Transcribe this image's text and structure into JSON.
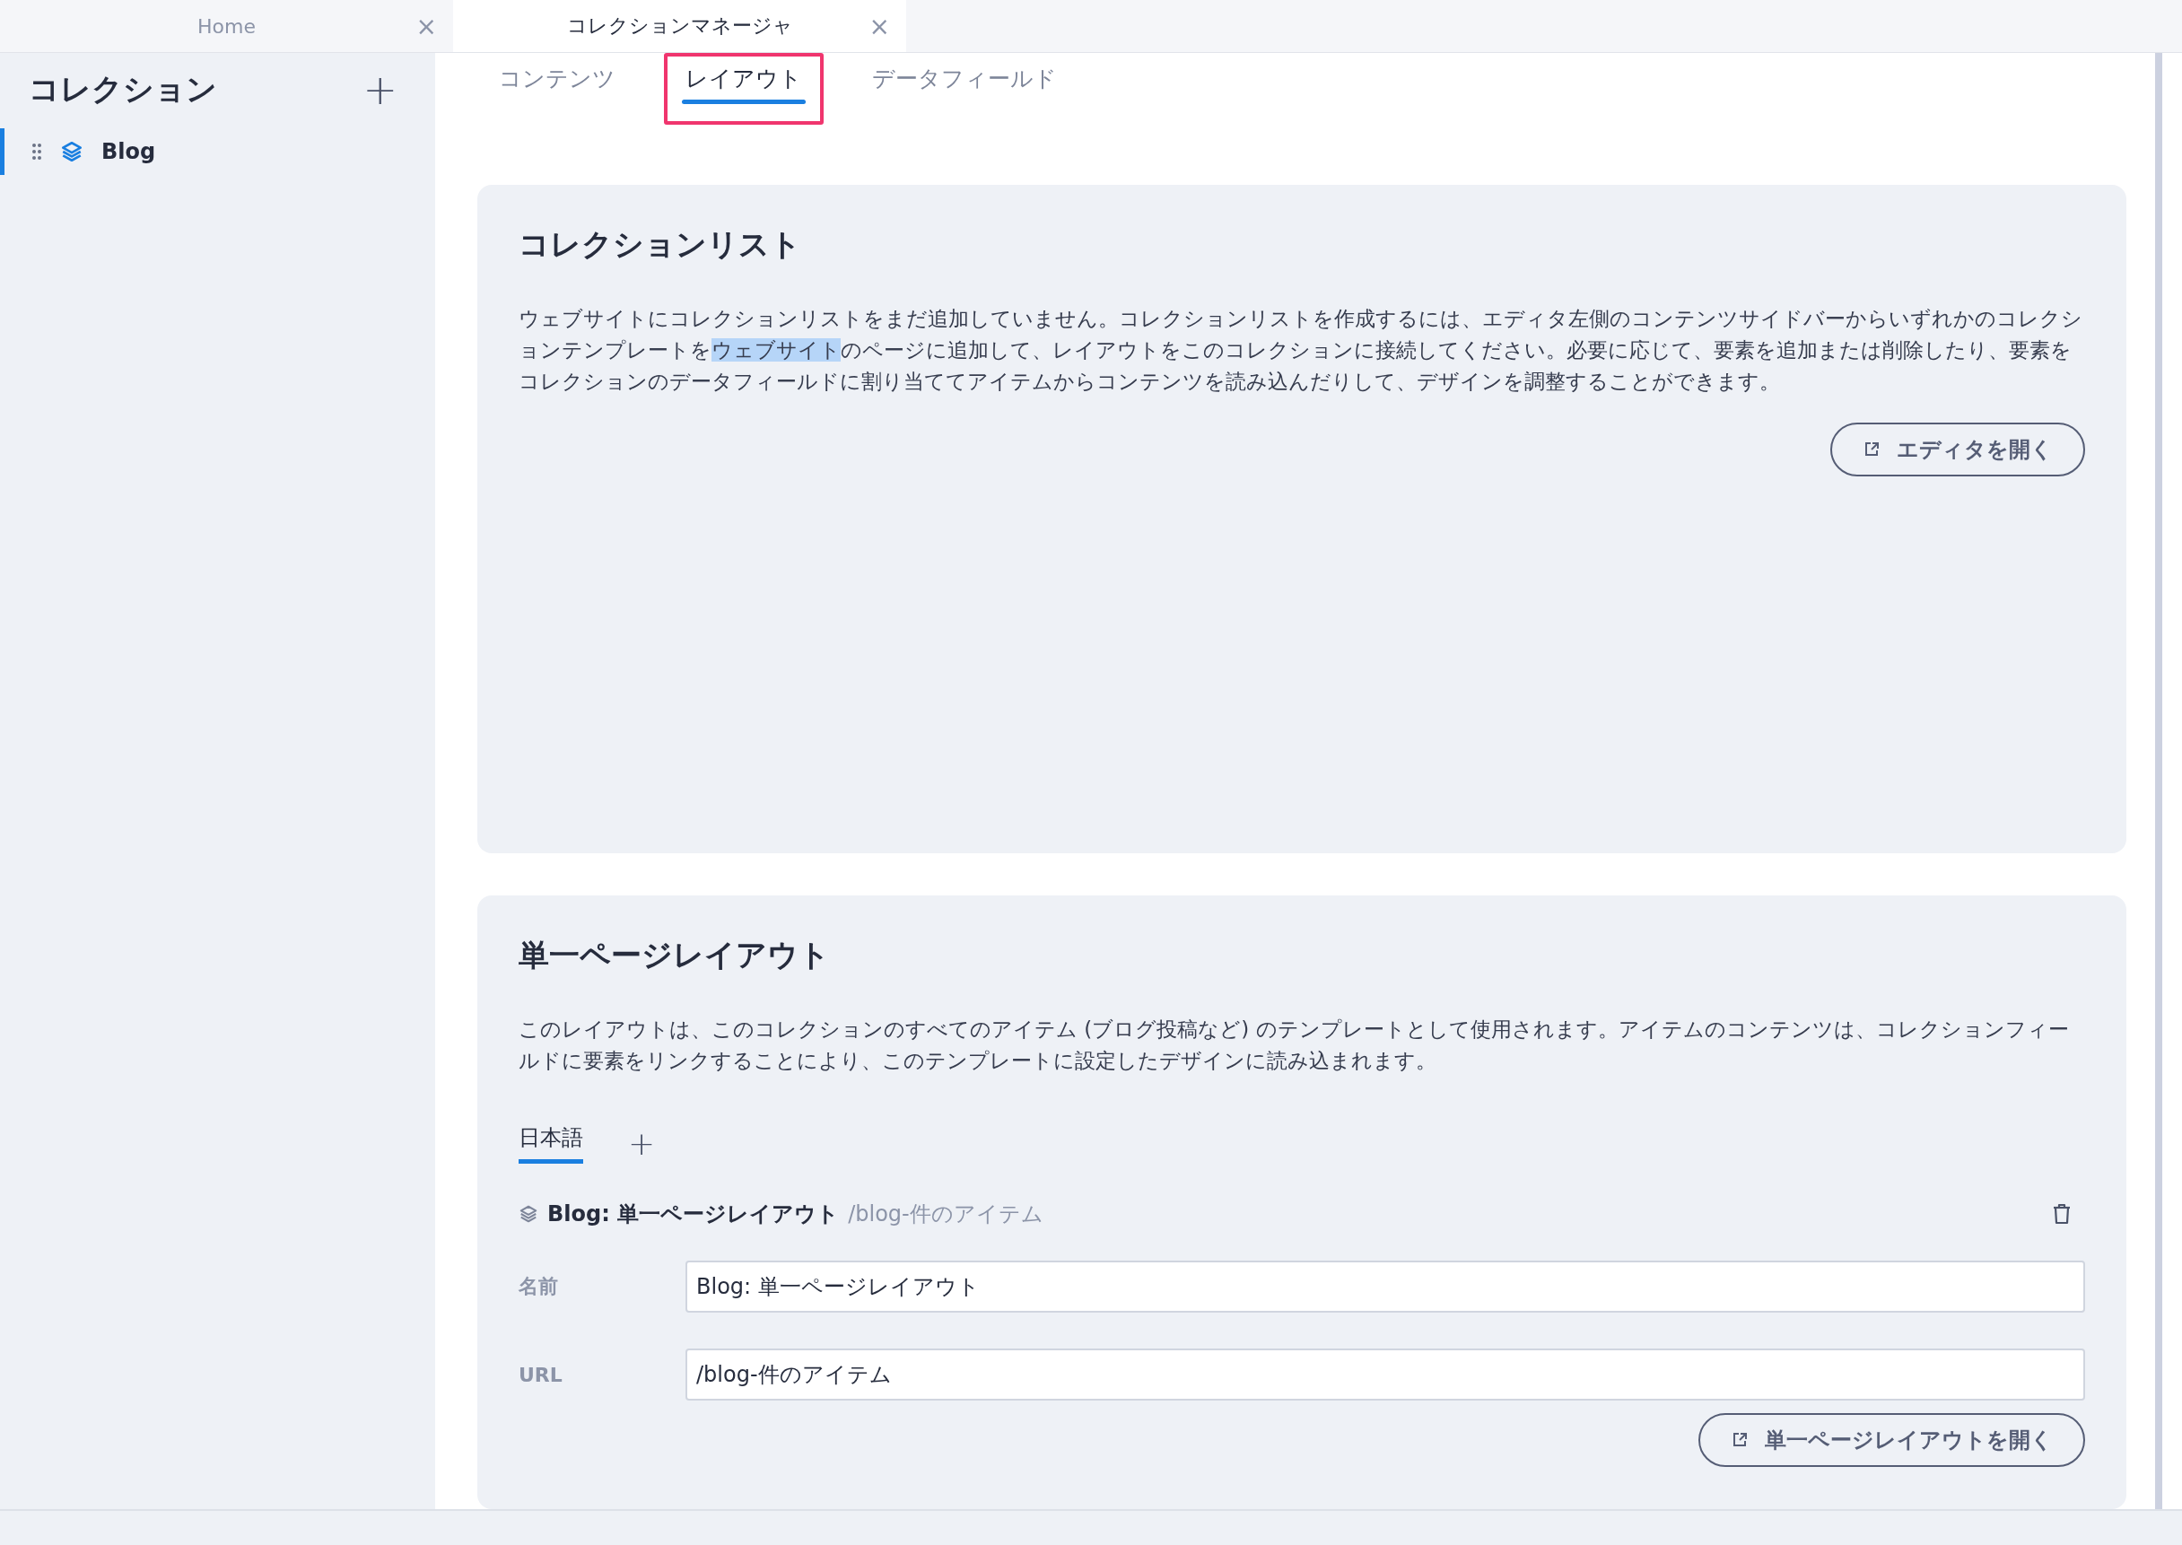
{
  "window_tabs": [
    {
      "label": "Home",
      "selected": false,
      "close": "×"
    },
    {
      "label": "コレクションマネージャ",
      "selected": true,
      "close": "×"
    }
  ],
  "sidebar": {
    "title": "コレクション",
    "add": "+",
    "items": [
      {
        "label": "Blog",
        "selected": true
      }
    ]
  },
  "tabs": [
    {
      "label": "コンテンツ",
      "selected": false,
      "highlighted": false
    },
    {
      "label": "レイアウト",
      "selected": true,
      "highlighted": true
    },
    {
      "label": "データフィールド",
      "selected": false,
      "highlighted": false
    }
  ],
  "collection_list": {
    "title": "コレクションリスト",
    "text_parts": [
      {
        "text": "ウェブサイトにコレクションリストをまだ追加していません。コレクションリストを作成するには、エディタ左側のコンテンツサイドバーからいずれかのコレクションテンプレートを",
        "selected": false
      },
      {
        "text": "ウェブサイト",
        "selected": true
      },
      {
        "text": "のページに追加して、レイアウトをこのコレクションに接続してください。必要に応じて、要素を追加または削除したり、要素をコレクションのデータフィールドに割り当ててアイテムからコンテンツを読み込んだりして、デザインを調整することができます。",
        "selected": false
      }
    ],
    "button": "エディタを開く"
  },
  "single_page": {
    "title": "単一ページレイアウト",
    "text": "このレイアウトは、このコレクションのすべてのアイテム (ブログ投稿など) のテンプレートとして使用されます。アイテムのコンテンツは、コレクションフィールドに要素をリンクすることにより、このテンプレートに設定したデザインに読み込まれます。",
    "language_tabs": [
      {
        "label": "日本語",
        "selected": true
      }
    ],
    "add": "+",
    "layout_name": "Blog: 単一ページレイアウト",
    "layout_path": "/blog-件のアイテム",
    "fields": [
      {
        "label": "名前",
        "value": "Blog: 単一ページレイアウト"
      },
      {
        "label": "URL",
        "value": "/blog-件のアイテム"
      }
    ],
    "button": "単一ページレイアウトを開く"
  }
}
